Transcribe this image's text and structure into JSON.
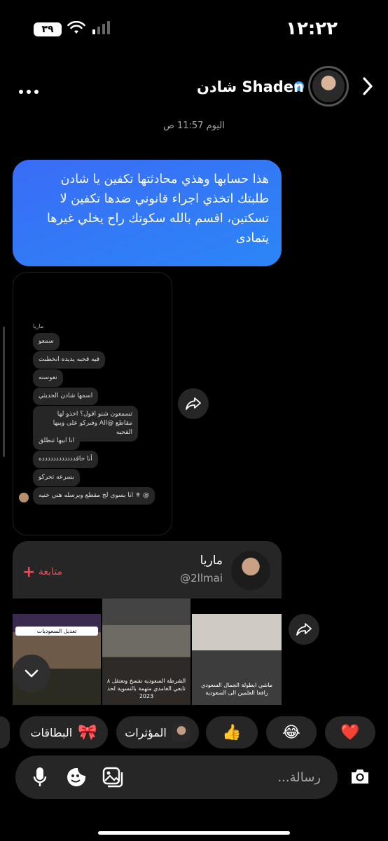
{
  "status_bar": {
    "time": "١٢:٢٢",
    "battery": "٣٩"
  },
  "header": {
    "name": "شادن Shaden",
    "verified": true
  },
  "timestamp": "اليوم 11:57 ص",
  "message": {
    "text": "هذا حسابها وهذي محادثتها تكفين يا شادن طلبتك اتخذي اجراء قانوني ضدها تكفين لا تسكتين، اقسم بالله سكوتك راح يخلي غيرها يتمادى",
    "color": "#3478f6"
  },
  "screenshot": {
    "sender": "ماريا",
    "messages": [
      "سمعو",
      "فيه قحبه يديده انخطبت",
      "نعوسنه",
      "اسمها شادن الحديثي",
      "تسمعون شنو اقول؟ اخذو لها مقاطع @All وفبركو على ويبها القحبه",
      "انا ابيها تنطلق",
      "أنا حاقدددددددددددده",
      "بسرعه تحركو",
      "@ ⚜ انا بسوي لج مقطع وبرسله هني خنيه"
    ]
  },
  "profile_card": {
    "name": "ماريا",
    "handle": "@2llmai",
    "follow_label": "متابعة",
    "follow_color": "#ed4956"
  },
  "media": {
    "banner": "تعديل السعوديات",
    "caption_2": "الشرطة السعودية تفسخ وتعتقل ٨ تابعي الغامدي متهمة بالنسوية لحد 2023",
    "caption_3": "ماشي ابطولة الجمال السعودي رافعا العلمين الى السعودية"
  },
  "chips": [
    {
      "emoji": "❤️"
    },
    {
      "emoji": "😂"
    },
    {
      "emoji": "👍"
    },
    {
      "label": "المؤثرات"
    },
    {
      "label": "البطاقات",
      "emoji": "🎀"
    }
  ],
  "composer": {
    "placeholder": "رسالة..."
  }
}
